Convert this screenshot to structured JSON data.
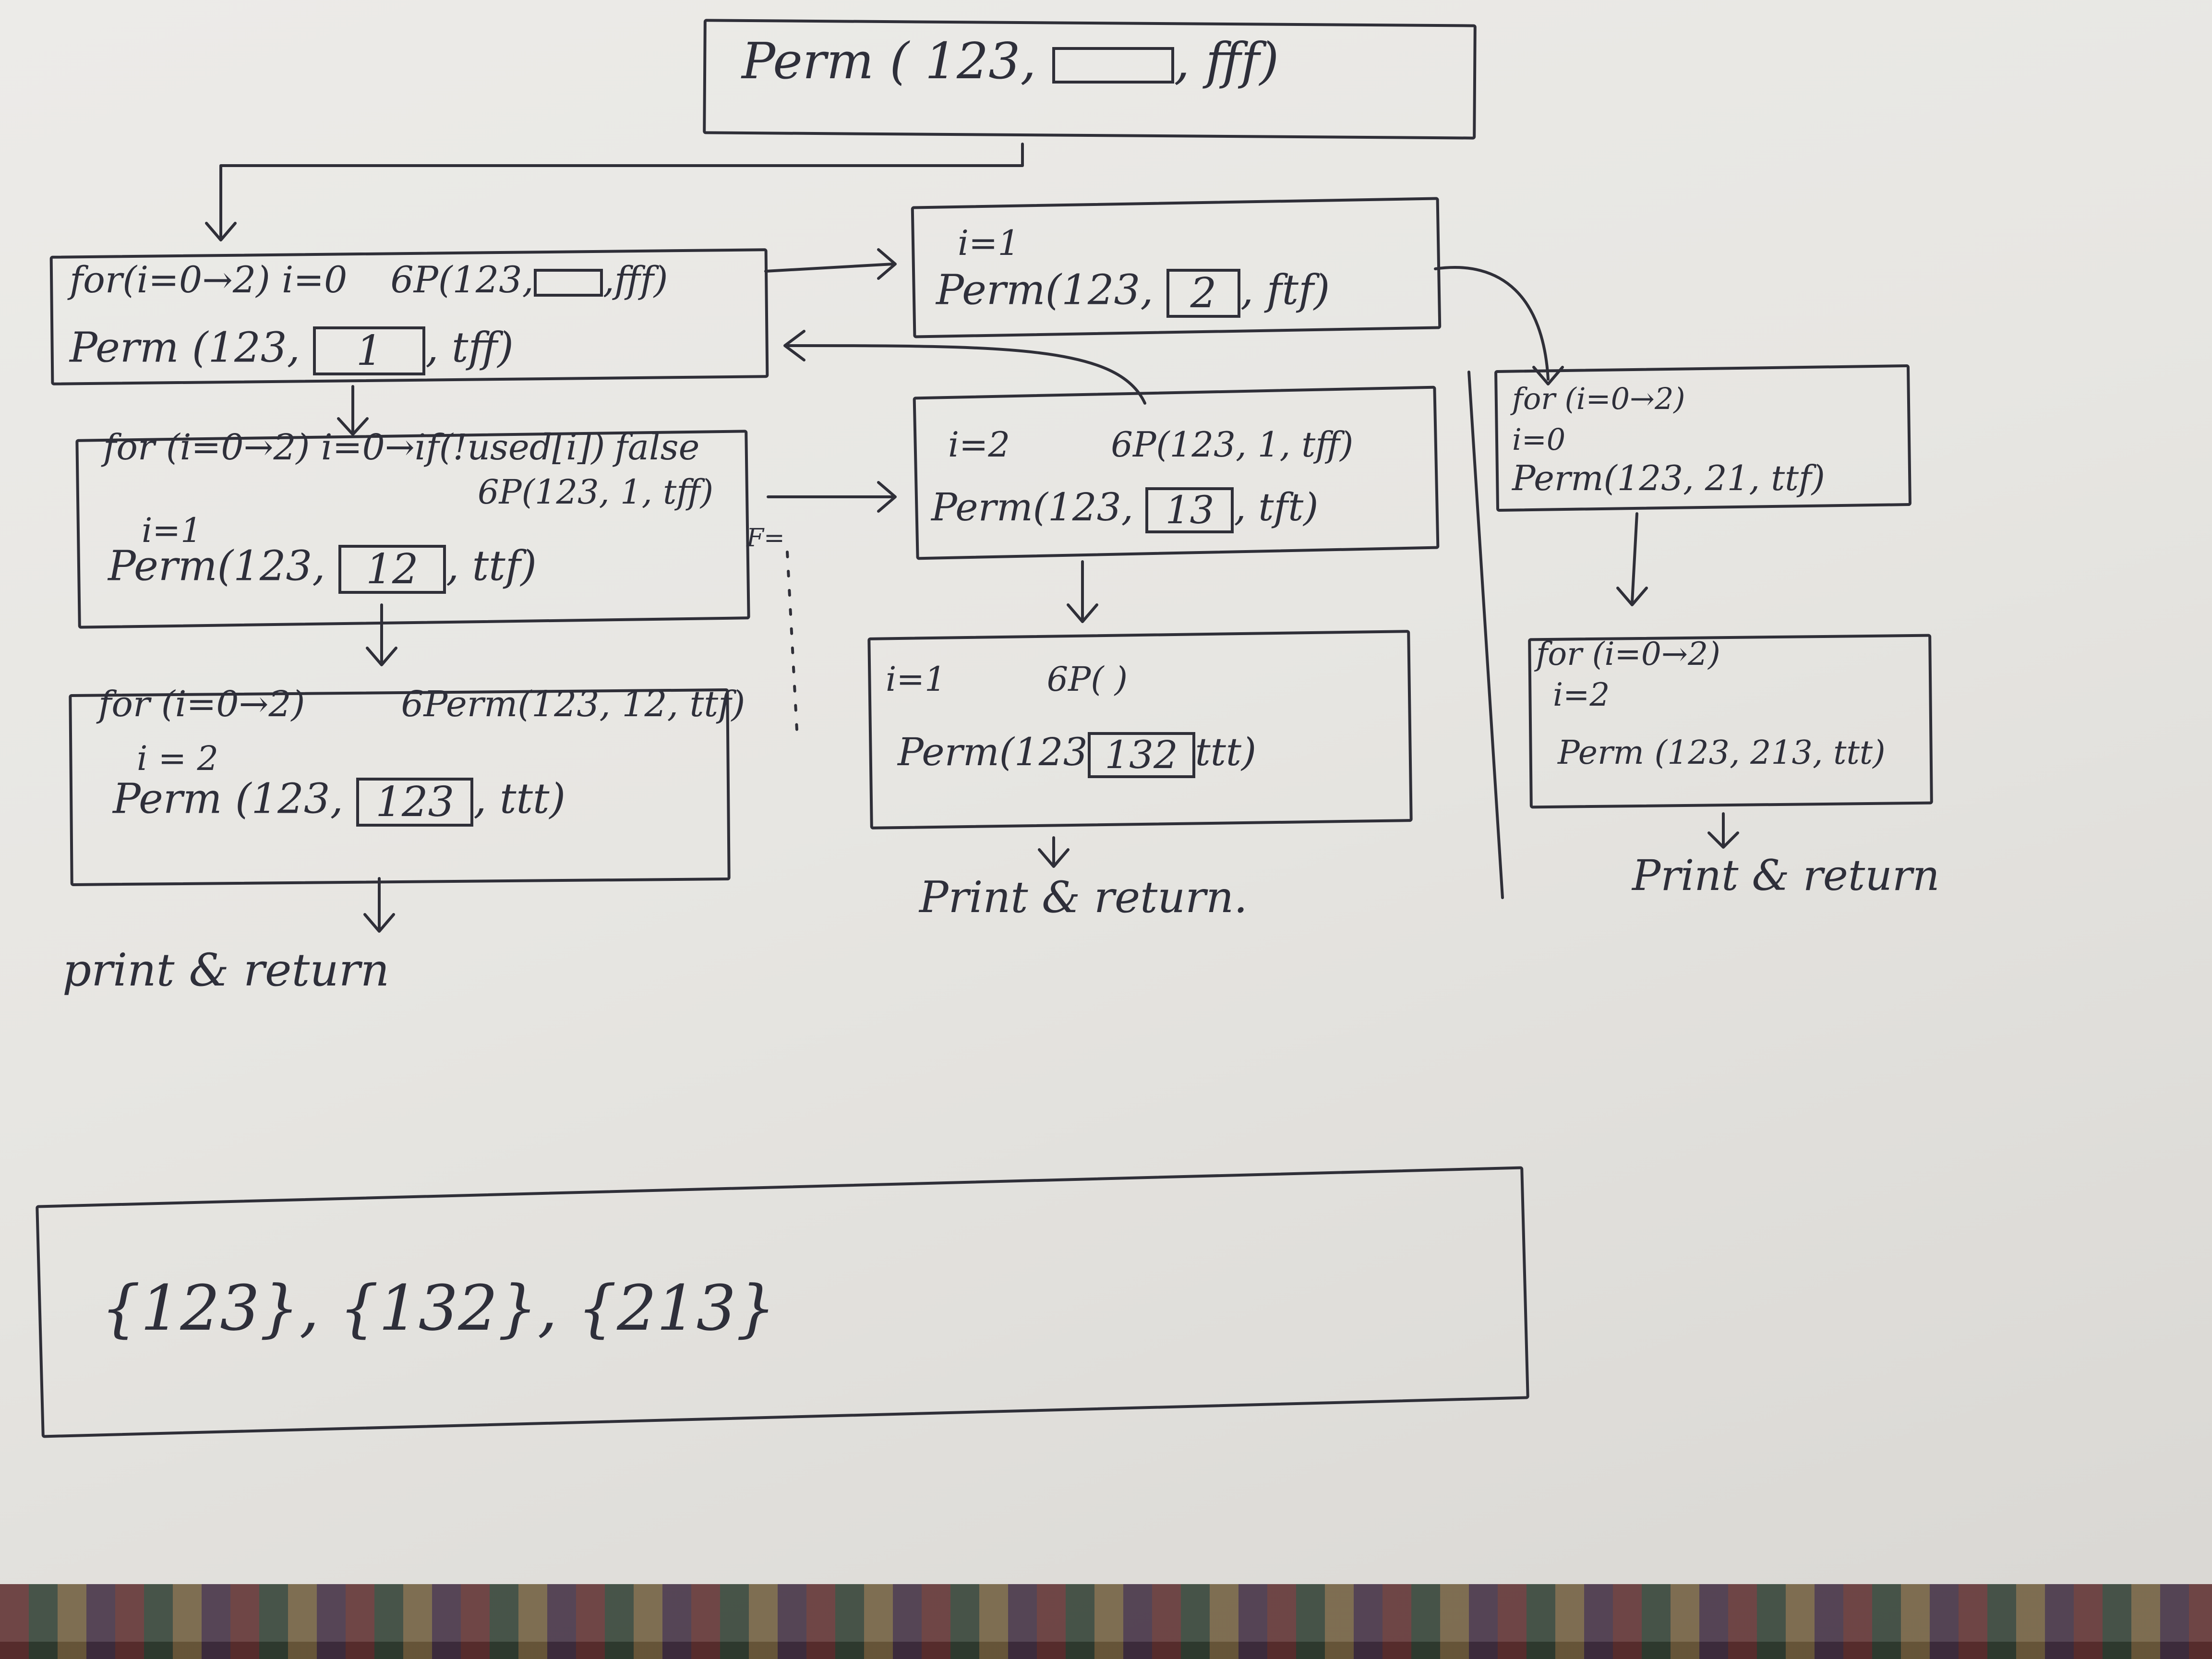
{
  "root": {
    "prefix": "Perm ( 123, ",
    "boxed": "",
    "suffix": ", fff)"
  },
  "left": {
    "b1": {
      "l1": "for(i=0→2) i=0",
      "l1b": "6P(123,",
      "l1box": "",
      "l1c": ",fff)",
      "l2": "Perm (123, ",
      "box": "1",
      "l2b": ", tff)"
    },
    "b2": {
      "l1": "for (i=0→2) i=0→if(!used[i])",
      "l1false": "false",
      "l2": "6P(123, 1, tff)",
      "l3": "i=1",
      "l4": "Perm(123, ",
      "box": "12",
      "l4b": ", ttf)"
    },
    "b3": {
      "l1": "for (i=0→2)",
      "l1b": "6Perm(123, 12, ttf)",
      "l2": "i = 2",
      "l3": "Perm (123, ",
      "box": "123",
      "l3b": ", ttt)"
    },
    "result": "print & return"
  },
  "middle": {
    "b1": {
      "l1": "i=1",
      "l2": "Perm(123, ",
      "box": "2",
      "l2b": ", ftf)"
    },
    "b2": {
      "l1": "i=2",
      "l1b": "6P(123, 1, tff)",
      "l2": "Perm(123, ",
      "box": "13",
      "l2b": ", tft)"
    },
    "b3": {
      "l1": "i=1",
      "l1b": "6P( )",
      "l2": "Perm(123",
      "box": "132",
      "l2b": "ttt)"
    },
    "result": "Print & return.",
    "f_mark": "F="
  },
  "right": {
    "b1": {
      "l1": "for (i=0→2)",
      "l2": "i=0",
      "l3": "Perm(123, 21, ttf)"
    },
    "b2": {
      "l1": "for (i=0→2)",
      "l2": "i=2",
      "l3": "Perm (123, 213, ttt)"
    },
    "result": "Print & return"
  },
  "final": {
    "text": "{123}, {132}, {213}"
  }
}
